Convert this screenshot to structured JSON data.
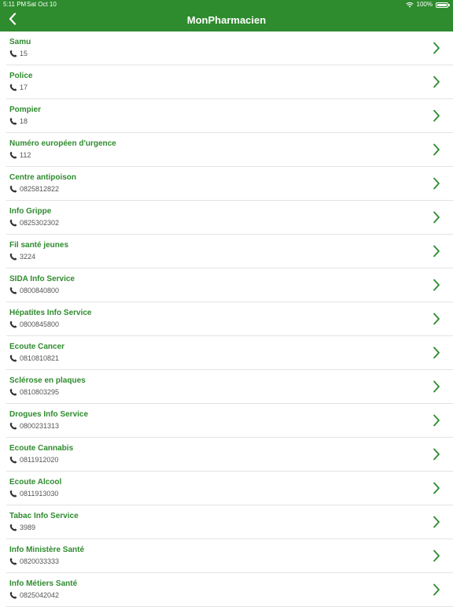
{
  "status_bar": {
    "time": "5:11 PM",
    "date": "Sat Oct 10",
    "battery": "100%"
  },
  "header": {
    "title": "MonPharmacien",
    "back_icon": "chevron-left-icon"
  },
  "colors": {
    "brand": "#2e8b2e",
    "text_secondary": "#555555",
    "divider": "#e3e3e3"
  },
  "contacts": [
    {
      "name": "Samu",
      "phone": "15"
    },
    {
      "name": "Police",
      "phone": "17"
    },
    {
      "name": "Pompier",
      "phone": "18"
    },
    {
      "name": "Numéro européen d'urgence",
      "phone": "112"
    },
    {
      "name": "Centre antipoison",
      "phone": "0825812822"
    },
    {
      "name": "Info Grippe",
      "phone": "0825302302"
    },
    {
      "name": "Fil santé jeunes",
      "phone": "3224"
    },
    {
      "name": "SIDA Info Service",
      "phone": "0800840800"
    },
    {
      "name": "Hépatites Info Service",
      "phone": "0800845800"
    },
    {
      "name": "Ecoute Cancer",
      "phone": "0810810821"
    },
    {
      "name": "Sclérose en plaques",
      "phone": "0810803295"
    },
    {
      "name": "Drogues Info Service",
      "phone": "0800231313"
    },
    {
      "name": "Ecoute Cannabis",
      "phone": "0811912020"
    },
    {
      "name": "Ecoute Alcool",
      "phone": "0811913030"
    },
    {
      "name": "Tabac Info Service",
      "phone": "3989"
    },
    {
      "name": "Info Ministère Santé",
      "phone": "0820033333"
    },
    {
      "name": "Info Métiers Santé",
      "phone": "0825042042"
    }
  ]
}
